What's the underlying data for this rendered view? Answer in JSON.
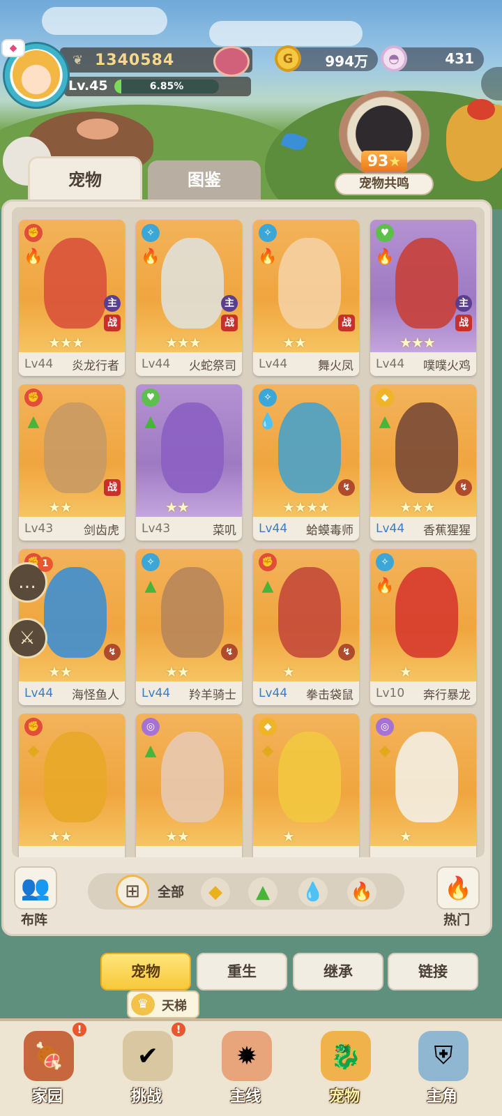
{
  "hud": {
    "score": "1340584",
    "level": "Lv.45",
    "xp_percent_label": "6.85%",
    "xp_fraction": 0.0685,
    "gold": "994万",
    "shells": "431"
  },
  "resonance": {
    "level": "93",
    "star": "★",
    "label": "宠物共鸣"
  },
  "tabs": [
    {
      "label": "宠物"
    },
    {
      "label": "图鉴"
    }
  ],
  "pets": [
    {
      "lv": "Lv44",
      "name": "炎龙行者",
      "stars": "★★★",
      "role": "atk",
      "element": "fire",
      "main": true,
      "battle": true,
      "blue": false,
      "bg": "orange"
    },
    {
      "lv": "Lv44",
      "name": "火蛇祭司",
      "stars": "★★★",
      "role": "mag",
      "element": "fire",
      "main": true,
      "battle": true,
      "blue": false,
      "bg": "orange"
    },
    {
      "lv": "Lv44",
      "name": "舞火凤",
      "stars": "★★",
      "role": "mag",
      "element": "fire",
      "main": false,
      "battle": true,
      "blue": false,
      "bg": "orange"
    },
    {
      "lv": "Lv44",
      "name": "噗噗火鸡",
      "stars": "★★★",
      "role": "heal",
      "element": "fire",
      "main": true,
      "battle": true,
      "blue": false,
      "bg": "purple"
    },
    {
      "lv": "Lv43",
      "name": "剑齿虎",
      "stars": "★★",
      "role": "atk",
      "element": "grass",
      "main": false,
      "battle": true,
      "blue": false,
      "bg": "orange"
    },
    {
      "lv": "Lv43",
      "name": "菜叽",
      "stars": "★★",
      "role": "heal",
      "element": "grass",
      "main": false,
      "battle": false,
      "blue": false,
      "bg": "purple"
    },
    {
      "lv": "Lv44",
      "name": "蛤蟆毒师",
      "stars": "★★★★",
      "role": "mag",
      "element": "water",
      "main": false,
      "battle": false,
      "blue": true,
      "bg": "orange",
      "ord": true
    },
    {
      "lv": "Lv44",
      "name": "香蕉猩猩",
      "stars": "★★★",
      "role": "def",
      "element": "grass",
      "main": false,
      "battle": false,
      "blue": true,
      "bg": "orange",
      "ord": true
    },
    {
      "lv": "Lv44",
      "name": "海怪鱼人",
      "stars": "★★",
      "role": "atk",
      "element": "water",
      "main": false,
      "battle": false,
      "blue": true,
      "bg": "orange",
      "ord": true
    },
    {
      "lv": "Lv44",
      "name": "羚羊骑士",
      "stars": "★★",
      "role": "mag",
      "element": "grass",
      "main": false,
      "battle": false,
      "blue": true,
      "bg": "orange",
      "ord": true
    },
    {
      "lv": "Lv44",
      "name": "拳击袋鼠",
      "stars": "★",
      "role": "atk",
      "element": "grass",
      "main": false,
      "battle": false,
      "blue": true,
      "bg": "orange",
      "ord": true
    },
    {
      "lv": "Lv10",
      "name": "奔行暴龙",
      "stars": "★",
      "role": "mag",
      "element": "fire",
      "main": false,
      "battle": false,
      "blue": false,
      "bg": "orange"
    },
    {
      "lv": "",
      "name": "",
      "stars": "★★",
      "role": "atk",
      "element": "earth",
      "main": false,
      "battle": false,
      "blue": false,
      "bg": "orange"
    },
    {
      "lv": "",
      "name": "",
      "stars": "★★",
      "role": "psy",
      "element": "grass",
      "main": false,
      "battle": false,
      "blue": false,
      "bg": "orange"
    },
    {
      "lv": "",
      "name": "",
      "stars": "★",
      "role": "def",
      "element": "earth",
      "main": false,
      "battle": false,
      "blue": false,
      "bg": "orange"
    },
    {
      "lv": "",
      "name": "",
      "stars": "★",
      "role": "psy",
      "element": "earth",
      "main": false,
      "battle": false,
      "blue": false,
      "bg": "orange"
    }
  ],
  "tag_labels": {
    "main": "主",
    "battle": "战"
  },
  "side_buttons": {
    "chat_badge": "1"
  },
  "filter": {
    "formation_label": "布阵",
    "all_label": "全部",
    "hot_label": "热门"
  },
  "subtabs": [
    {
      "label": "宠物"
    },
    {
      "label": "重生"
    },
    {
      "label": "继承"
    },
    {
      "label": "链接"
    }
  ],
  "ladder": {
    "label": "天梯"
  },
  "nav": [
    {
      "label": "家园",
      "badge": "!"
    },
    {
      "label": "挑战",
      "badge": "!"
    },
    {
      "label": "主线",
      "badge": ""
    },
    {
      "label": "宠物",
      "badge": ""
    },
    {
      "label": "主角",
      "badge": ""
    }
  ],
  "colors": {
    "card_orange": "#f0a53f",
    "card_purple": "#9e7ac2",
    "level_blue": "#3b7ac8",
    "active_tab_yellow": "#f7c83a"
  }
}
